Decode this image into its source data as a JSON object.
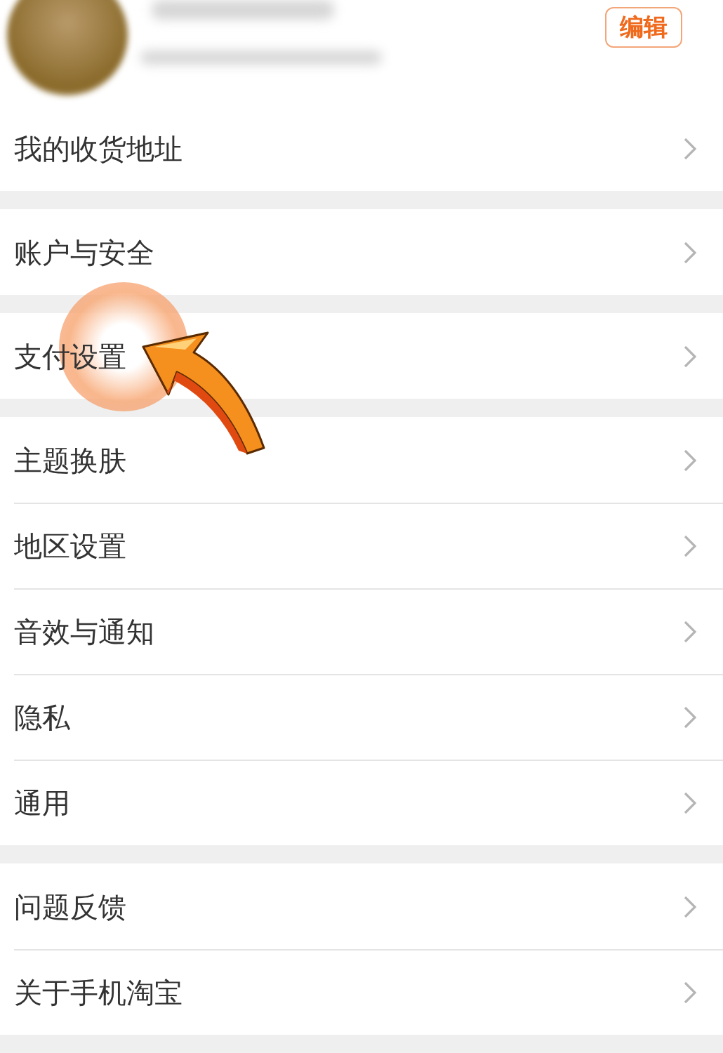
{
  "profile": {
    "edit_button": "编辑"
  },
  "groups": [
    {
      "items": [
        {
          "label": "我的收货地址"
        }
      ]
    },
    {
      "items": [
        {
          "label": "账户与安全"
        }
      ]
    },
    {
      "items": [
        {
          "label": "支付设置",
          "kind": "highlighted"
        }
      ]
    },
    {
      "items": [
        {
          "label": "主题换肤"
        },
        {
          "label": "地区设置"
        },
        {
          "label": "音效与通知"
        },
        {
          "label": "隐私"
        },
        {
          "label": "通用"
        }
      ]
    },
    {
      "items": [
        {
          "label": "问题反馈"
        },
        {
          "label": "关于手机淘宝"
        }
      ]
    }
  ]
}
